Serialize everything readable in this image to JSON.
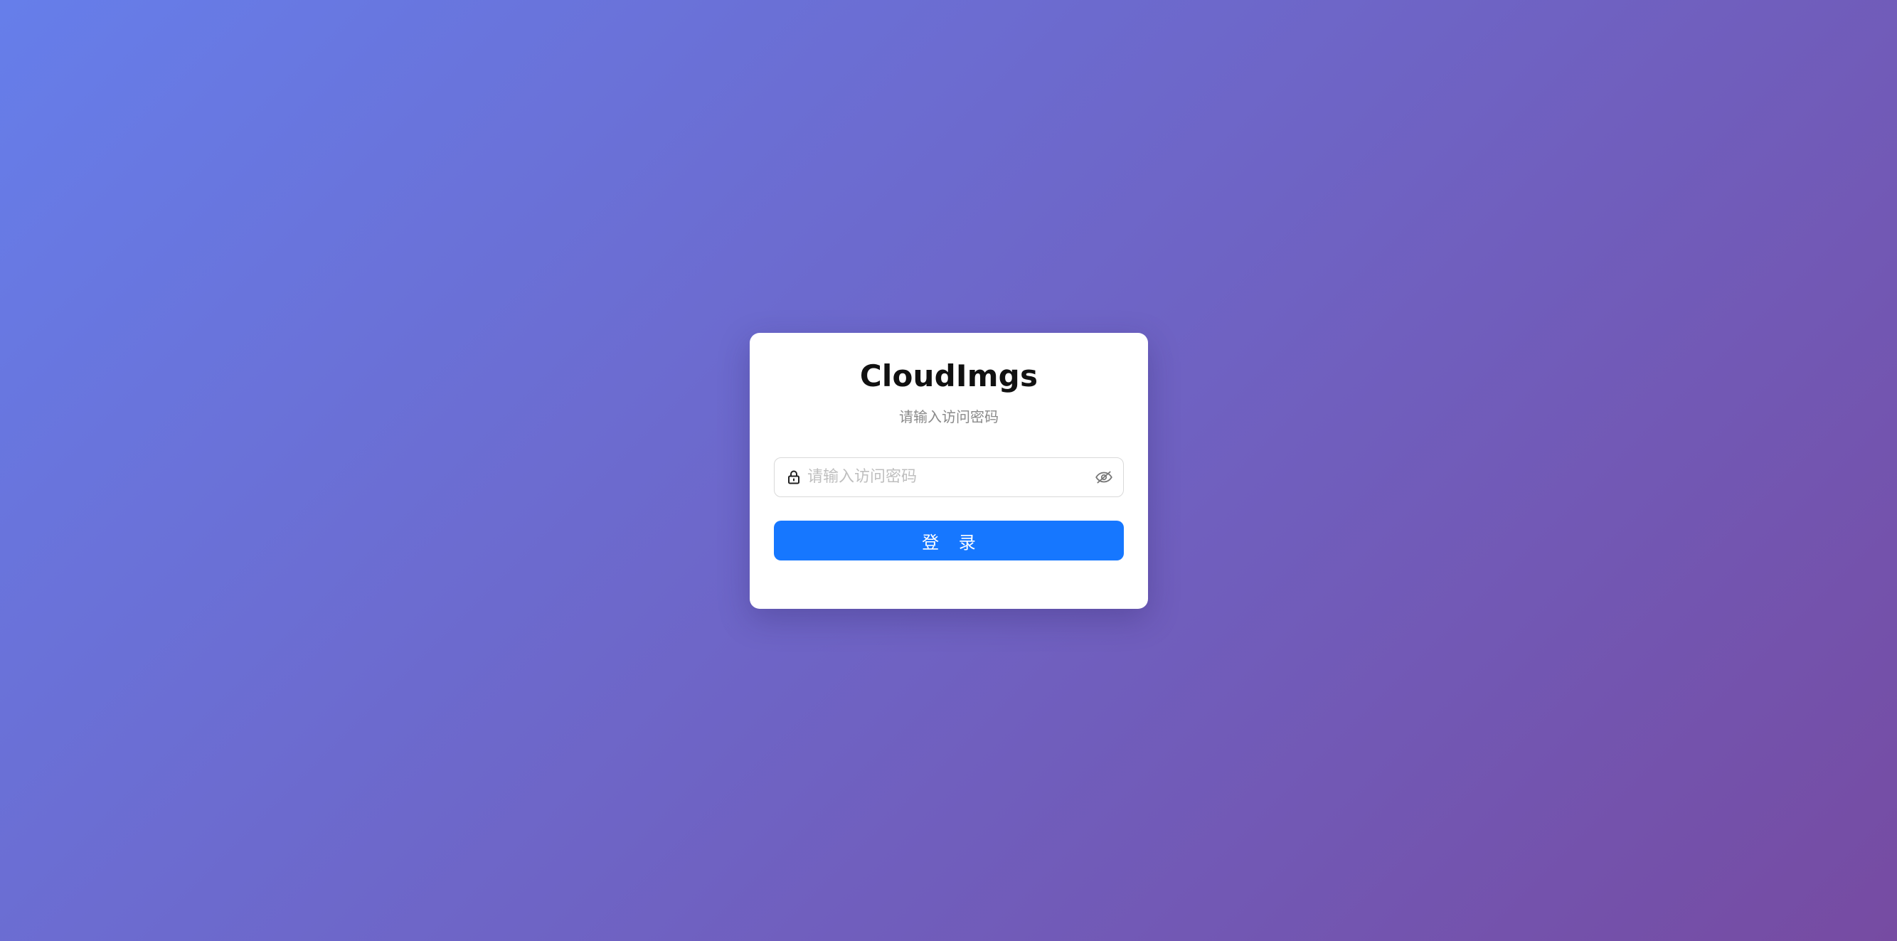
{
  "app": {
    "title": "CloudImgs",
    "subtitle": "请输入访问密码"
  },
  "password_field": {
    "value": "",
    "placeholder": "请输入访问密码",
    "prefix_icon": "lock-icon",
    "suffix_icon": "eye-invisible-icon"
  },
  "login_button": {
    "label": "登 录"
  },
  "colors": {
    "background_start": "#667eea",
    "background_end": "#764ba2",
    "primary": "#1677ff",
    "card": "#ffffff"
  }
}
